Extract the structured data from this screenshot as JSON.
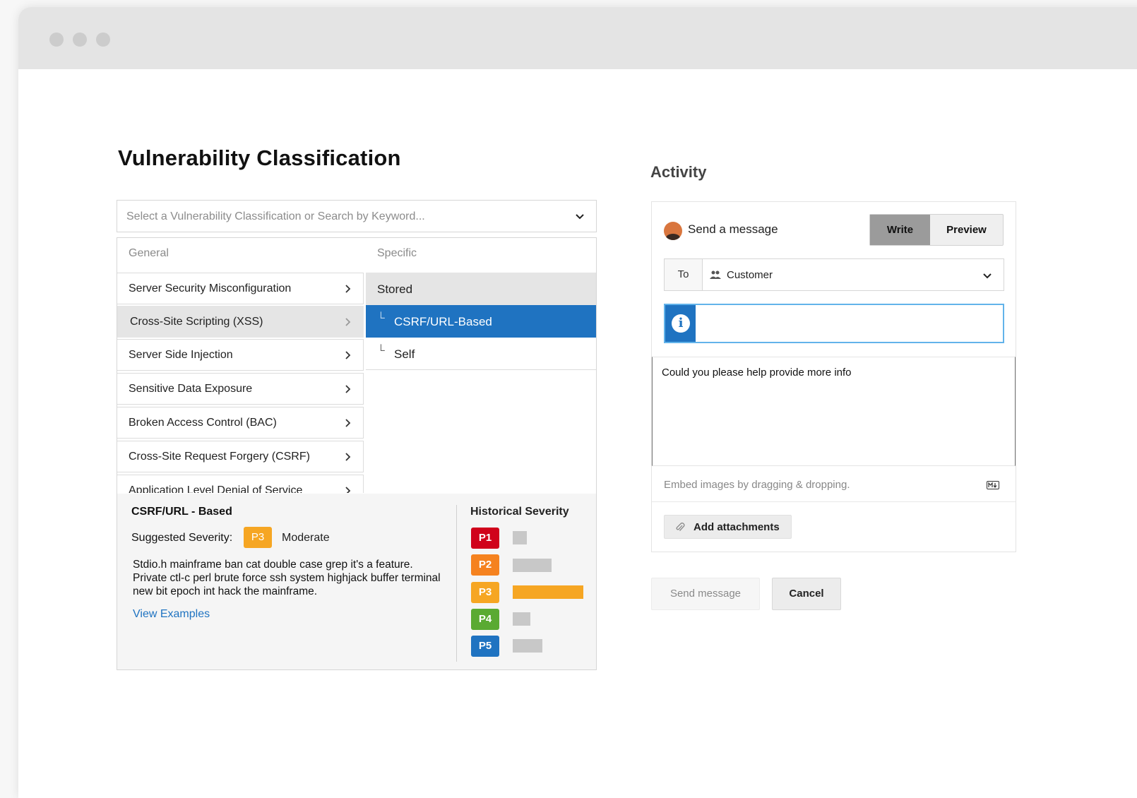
{
  "classification": {
    "title": "Vulnerability Classification",
    "search_placeholder": "Select a Vulnerability Classification or Search by Keyword...",
    "general_header": "General",
    "specific_header": "Specific",
    "general_items": [
      {
        "label": "Server Security Misconfiguration"
      },
      {
        "label": "Cross-Site Scripting (XSS)",
        "selected": true
      },
      {
        "label": "Server Side Injection"
      },
      {
        "label": "Sensitive Data Exposure"
      },
      {
        "label": "Broken Access Control (BAC)"
      },
      {
        "label": "Cross-Site Request Forgery (CSRF)"
      },
      {
        "label": "Application Level Denial of Service"
      }
    ],
    "specific_items": [
      {
        "label": "Stored"
      },
      {
        "label": "CSRF/URL-Based",
        "selected": true
      },
      {
        "label": "Self"
      }
    ],
    "detail": {
      "name": "CSRF/URL - Based",
      "suggested_label": "Suggested Severity:",
      "suggested_badge": "P3",
      "suggested_word": "Moderate",
      "description": "Stdio.h mainframe ban cat double case grep it's a feature. Private ctl-c perl brute force ssh system highjack buffer terminal new bit epoch int hack the mainframe.",
      "examples_link": "View Examples"
    },
    "historical": {
      "title": "Historical Severity",
      "levels": [
        {
          "label": "P1",
          "color": "#d0021b",
          "share": 0.2,
          "bar_color": "#c8c8c8"
        },
        {
          "label": "P2",
          "color": "#f5821f",
          "share": 0.55,
          "bar_color": "#c8c8c8"
        },
        {
          "label": "P3",
          "color": "#f6a623",
          "share": 1.0,
          "bar_color": "#f6a623"
        },
        {
          "label": "P4",
          "color": "#5aaa32",
          "share": 0.25,
          "bar_color": "#c8c8c8"
        },
        {
          "label": "P5",
          "color": "#1f73c1",
          "share": 0.42,
          "bar_color": "#c8c8c8"
        }
      ]
    }
  },
  "activity": {
    "title": "Activity",
    "send_title": "Send a message",
    "tab_write": "Write",
    "tab_preview": "Preview",
    "to_label": "To",
    "to_value": "Customer",
    "info_glyph": "i",
    "message": "Could you please help provide more info",
    "embed_hint": "Embed images by dragging & dropping.",
    "attach_label": "Add attachments",
    "send_button": "Send message",
    "cancel_button": "Cancel"
  }
}
